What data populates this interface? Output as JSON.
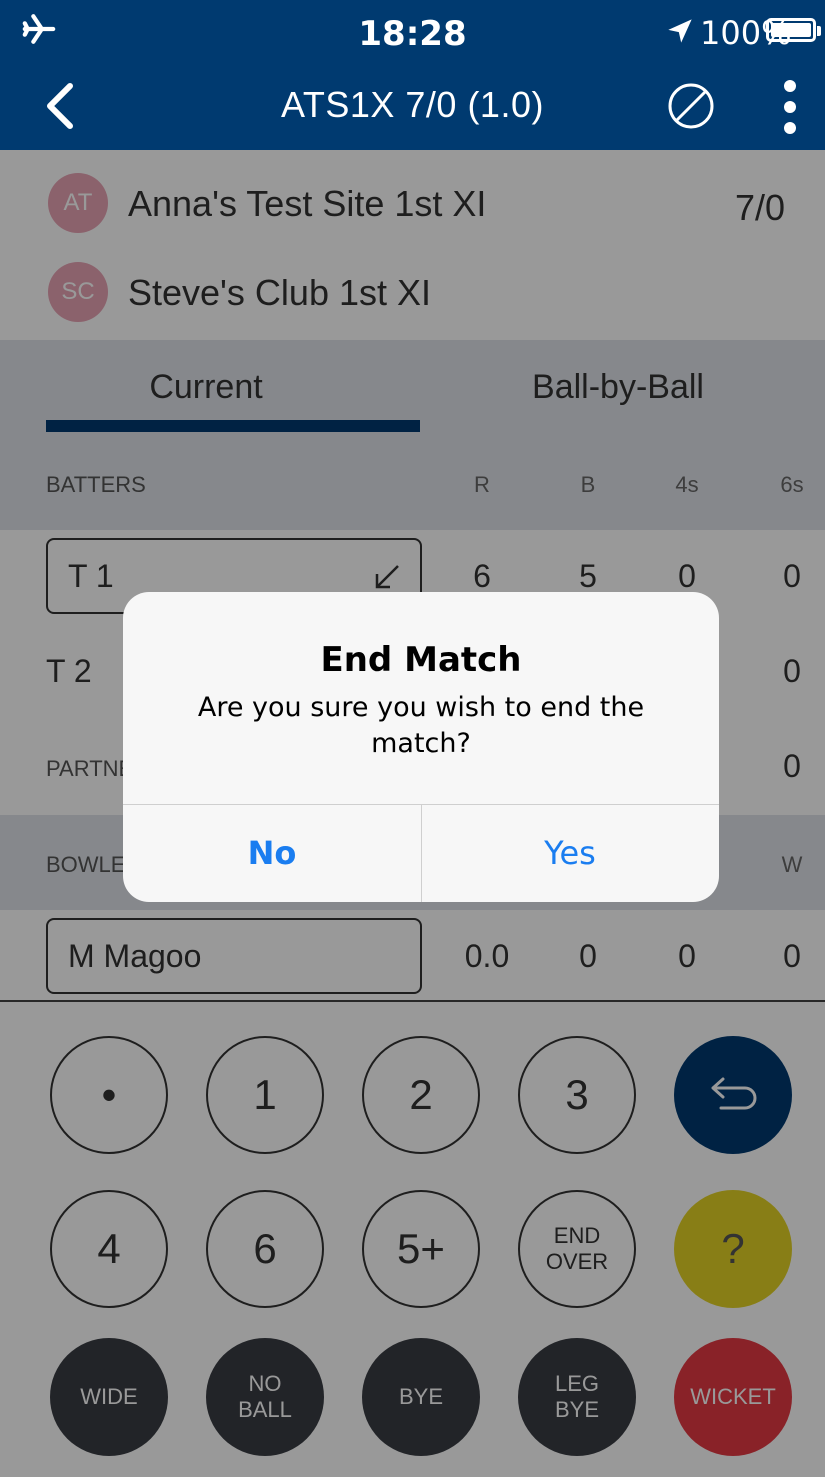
{
  "status": {
    "time": "18:28",
    "battery_pct": "100%"
  },
  "nav": {
    "title": "ATS1X 7/0 (1.0)"
  },
  "teams": [
    {
      "initials": "AT",
      "name": "Anna's Test Site 1st XI",
      "score": "7/0"
    },
    {
      "initials": "SC",
      "name": "Steve's Club 1st XI",
      "score": ""
    }
  ],
  "tabs": [
    {
      "label": "Current"
    },
    {
      "label": "Ball-by-Ball"
    }
  ],
  "batters": {
    "header": "BATTERS",
    "columns": [
      "R",
      "B",
      "4s",
      "6s"
    ],
    "rows": [
      {
        "name": "T 1",
        "r": "6",
        "b": "5",
        "fours": "0",
        "sixes": "0"
      },
      {
        "name": "T 2",
        "sixes": "0"
      }
    ],
    "partnership_label": "PARTNEI",
    "partnership_value": "0"
  },
  "bowlers": {
    "header": "BOWLEI",
    "last_column": "W",
    "row": {
      "name": "M Magoo",
      "o": "0.0",
      "m": "0",
      "r": "0",
      "w": "0"
    }
  },
  "keypad": {
    "row1": [
      "•",
      "1",
      "2",
      "3"
    ],
    "row2": [
      "4",
      "6",
      "5+"
    ],
    "end_over": [
      "END",
      "OVER"
    ],
    "help": "?",
    "row3": {
      "wide": "WIDE",
      "no_ball": [
        "NO",
        "BALL"
      ],
      "bye": "BYE",
      "leg_bye": [
        "LEG",
        "BYE"
      ],
      "wicket": "WICKET"
    }
  },
  "dialog": {
    "title": "End Match",
    "message": "Are you sure you wish to end the match?",
    "no": "No",
    "yes": "Yes"
  },
  "colors": {
    "nav": "#003a70",
    "accent_blue": "#1a7df0",
    "undo": "#003a70",
    "help": "#e3d325",
    "wicket": "#e53943",
    "dark_key": "#3a3d44"
  }
}
